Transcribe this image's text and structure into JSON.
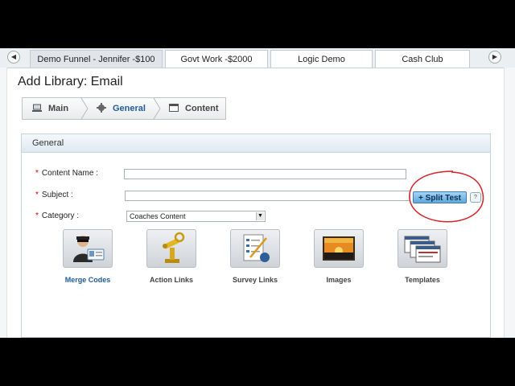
{
  "tabs": [
    {
      "label": "Demo Funnel - Jennifer -$100",
      "active": true
    },
    {
      "label": "Govt Work -$2000",
      "active": false
    },
    {
      "label": "Logic Demo",
      "active": false
    },
    {
      "label": "Cash Club",
      "active": false
    }
  ],
  "page": {
    "title": "Add Library: Email"
  },
  "wizard": {
    "steps": [
      {
        "label": "Main",
        "icon": "monitor-icon"
      },
      {
        "label": "General",
        "icon": "gear-icon",
        "active": true
      },
      {
        "label": "Content",
        "icon": "window-icon"
      }
    ]
  },
  "panel": {
    "title": "General"
  },
  "form": {
    "required_mark": "*",
    "content_name": {
      "label": "Content Name :",
      "value": ""
    },
    "subject": {
      "label": "Subject :",
      "value": ""
    },
    "category": {
      "label": "Category :",
      "value": "Coaches Content"
    },
    "split_test": {
      "label": "+ Split Test"
    },
    "help_glyph": "?"
  },
  "tools": [
    {
      "label": "Merge Codes",
      "icon": "contact-card-icon",
      "selected": true
    },
    {
      "label": "Action Links",
      "icon": "robot-icon",
      "selected": false
    },
    {
      "label": "Survey Links",
      "icon": "survey-icon",
      "selected": false
    },
    {
      "label": "Images",
      "icon": "sunset-image-icon",
      "selected": false
    },
    {
      "label": "Templates",
      "icon": "templates-icon",
      "selected": false
    }
  ],
  "colors": {
    "accent": "#1f5c99",
    "required": "#cc0000",
    "annotation": "#d8232a"
  }
}
